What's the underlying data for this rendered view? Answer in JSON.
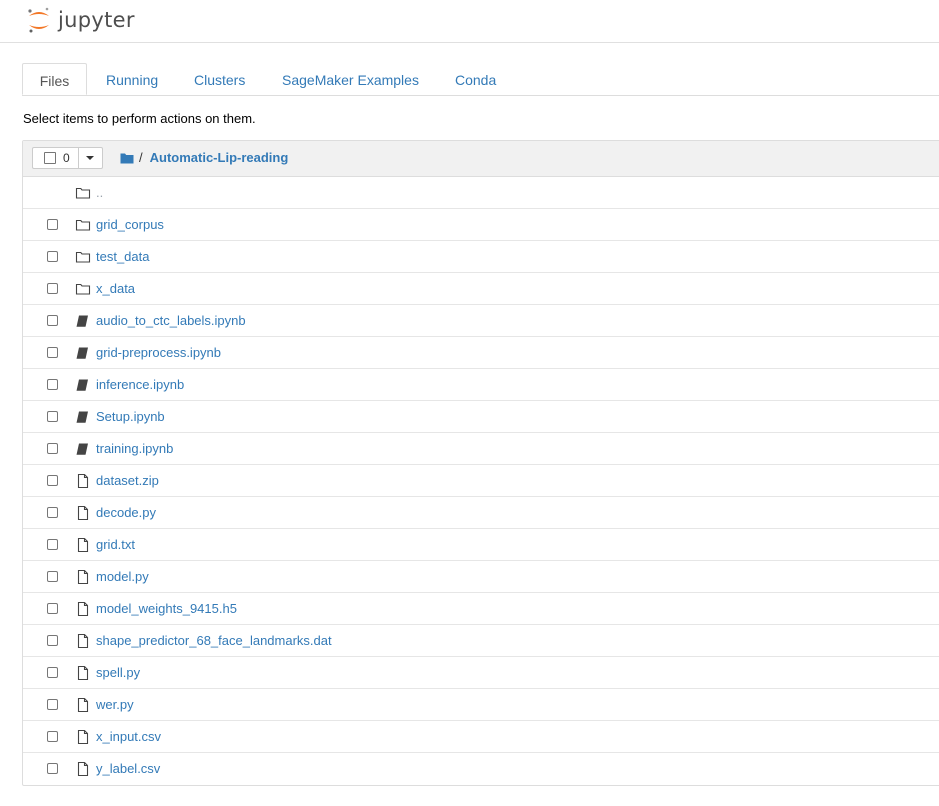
{
  "app": {
    "logo_text": "jupyter"
  },
  "tabs": [
    {
      "label": "Files",
      "active": true
    },
    {
      "label": "Running",
      "active": false
    },
    {
      "label": "Clusters",
      "active": false
    },
    {
      "label": "SageMaker Examples",
      "active": false
    },
    {
      "label": "Conda",
      "active": false
    }
  ],
  "hint": "Select items to perform actions on them.",
  "list_header": {
    "selected_count": "0",
    "breadcrumb_separator": "/",
    "current_directory": "Automatic-Lip-reading"
  },
  "parent_link": {
    "label": "..",
    "icon": "folder-icon"
  },
  "items": [
    {
      "name": "grid_corpus",
      "type": "folder",
      "icon": "folder-icon"
    },
    {
      "name": "test_data",
      "type": "folder",
      "icon": "folder-icon"
    },
    {
      "name": "x_data",
      "type": "folder",
      "icon": "folder-icon"
    },
    {
      "name": "audio_to_ctc_labels.ipynb",
      "type": "notebook",
      "icon": "notebook-icon"
    },
    {
      "name": "grid-preprocess.ipynb",
      "type": "notebook",
      "icon": "notebook-icon"
    },
    {
      "name": "inference.ipynb",
      "type": "notebook",
      "icon": "notebook-icon"
    },
    {
      "name": "Setup.ipynb",
      "type": "notebook",
      "icon": "notebook-icon"
    },
    {
      "name": "training.ipynb",
      "type": "notebook",
      "icon": "notebook-icon"
    },
    {
      "name": "dataset.zip",
      "type": "file",
      "icon": "file-icon"
    },
    {
      "name": "decode.py",
      "type": "file",
      "icon": "file-icon"
    },
    {
      "name": "grid.txt",
      "type": "file",
      "icon": "file-icon"
    },
    {
      "name": "model.py",
      "type": "file",
      "icon": "file-icon"
    },
    {
      "name": "model_weights_9415.h5",
      "type": "file",
      "icon": "file-icon"
    },
    {
      "name": "shape_predictor_68_face_landmarks.dat",
      "type": "file",
      "icon": "file-icon"
    },
    {
      "name": "spell.py",
      "type": "file",
      "icon": "file-icon"
    },
    {
      "name": "wer.py",
      "type": "file",
      "icon": "file-icon"
    },
    {
      "name": "x_input.csv",
      "type": "file",
      "icon": "file-icon"
    },
    {
      "name": "y_label.csv",
      "type": "file",
      "icon": "file-icon"
    }
  ],
  "colors": {
    "link": "#337ab7",
    "logo_orange": "#f37726",
    "header_bg": "#f1f1f1"
  }
}
